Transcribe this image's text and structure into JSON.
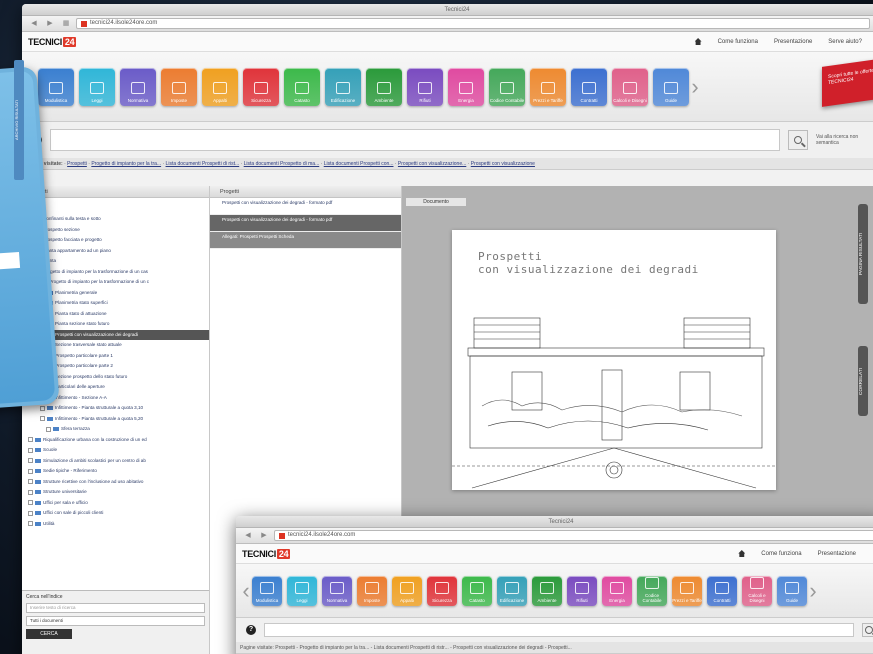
{
  "window_title": "Tecnici24",
  "url": "tecnici24.ilsole24ore.com",
  "brand": {
    "text": "TECNICI",
    "box": "24",
    "accent": "#e03a2a"
  },
  "top_nav": [
    "Come funziona",
    "Presentazione",
    "Serve aiuto?"
  ],
  "ribbon_tiles": [
    {
      "label": "Modulistica",
      "color": "#3a7fd0"
    },
    {
      "label": "Leggi",
      "color": "#2fb6d8"
    },
    {
      "label": "Normativa",
      "color": "#6a5bc8"
    },
    {
      "label": "Imposte",
      "color": "#ec7c30"
    },
    {
      "label": "Appalti",
      "color": "#f0a020"
    },
    {
      "label": "Sicurezza",
      "color": "#e0333a"
    },
    {
      "label": "Catasto",
      "color": "#3cb94a"
    },
    {
      "label": "Edificazione",
      "color": "#34a0b8"
    },
    {
      "label": "Ambiente",
      "color": "#2a9a3a"
    },
    {
      "label": "Rifiuti",
      "color": "#7a4bc0"
    },
    {
      "label": "Energia",
      "color": "#e04aa0"
    },
    {
      "label": "Codice Contabile",
      "color": "#44a85a"
    },
    {
      "label": "Prezzi e Tariffe",
      "color": "#ee8a30"
    },
    {
      "label": "Contratti",
      "color": "#3c6fd0"
    },
    {
      "label": "Calcoli e Disegni",
      "color": "#e0608a"
    },
    {
      "label": "Guide",
      "color": "#4f88d8"
    }
  ],
  "promo_text": "Scopri tutte le offerte di TECNICI24",
  "search_side_text": "Vai alla ricerca non semantica",
  "breadcrumb_label": "Pagine visitate:",
  "breadcrumb_items": [
    "Prospetti",
    "Progetto di impianto per la tra...",
    "Lista documenti Prospetti di rist...",
    "Lista documenti Prospetto di ma...",
    "Lista documenti Prospetti con...",
    "Prospetti con visualizzazione...",
    "Prospetti con visualizzazione"
  ],
  "left_pane_title": "Prospetti",
  "tree_items": [
    "Confinanti sulla testa e sotto",
    "Prospetto sezione",
    "Prospetto facciata e progetto",
    "Pianta appartamento ad un piano",
    "Pianta",
    "Progetto di impianto per la trasformazione di un cas",
    "Progetto di impianto per la trasformazione di un c",
    "Planimetria generale",
    "Planimetria stato superfici",
    "Pianta stato di attuazione",
    "Pianta sezione stato futuro",
    "Prospetti con visualizzazione dei degradi",
    "Sezione trasversale stato attuale",
    "Prospetto particolare parte 1",
    "Prospetto particolare parte 2",
    "Sezione prospetto dello stato futuro",
    "Particolari delle aperture",
    "Infittimento - Sezione A-A",
    "Infittimento - Pianta strutturale a quota 3,10",
    "Infittimento - Pianta strutturale a quota 5,20",
    "Sfera terrazza",
    "Riqualificazione urbana con la costruzione di un ed",
    "Scuole",
    "Simulazione di ambiti scolastici per un centro di ab",
    "Sedie tipiche - Riferimento",
    "Strutture ricettive con l'inclusione ad uso abitativo",
    "Strutture universitarie",
    "Uffici per sala e ufficio",
    "Uffici con sale di piccoli clienti",
    "Utilità"
  ],
  "filter": {
    "title": "Cerca nell'indice",
    "placeholder": "Inserire testo di ricerca",
    "select_value": "Tutti i documenti",
    "button": "CERCA"
  },
  "middle_pane_title": "Progetti",
  "list_items": [
    "Prospetti con visualizzazione dei degradi - formato pdf",
    "Prospetti con visualizzazione dei degradi - formato pdf",
    "Allegati: Prospetti Prospetti Scheda"
  ],
  "viewer_tab": "Documento",
  "sheet_title_lines": [
    "Prospetti",
    "con visualizzazione dei degradi"
  ],
  "side_tabs": {
    "risultati": "PAGINA RISULTATI",
    "correlati": "CORRELATI",
    "left": "ARCHIVIO RISULTATI"
  },
  "front_window": {
    "title": "Tecnici24",
    "url": "tecnici24.ilsole24ore.com",
    "nav": [
      "Come funziona",
      "Presentazione"
    ],
    "breadcrumb": "Pagine visitate: Prospetti - Progetto di impianto per la tra... - Lista documenti Prospetti di ristr... - Prospetti con visualizzazione dei degradi - Prospetti..."
  }
}
